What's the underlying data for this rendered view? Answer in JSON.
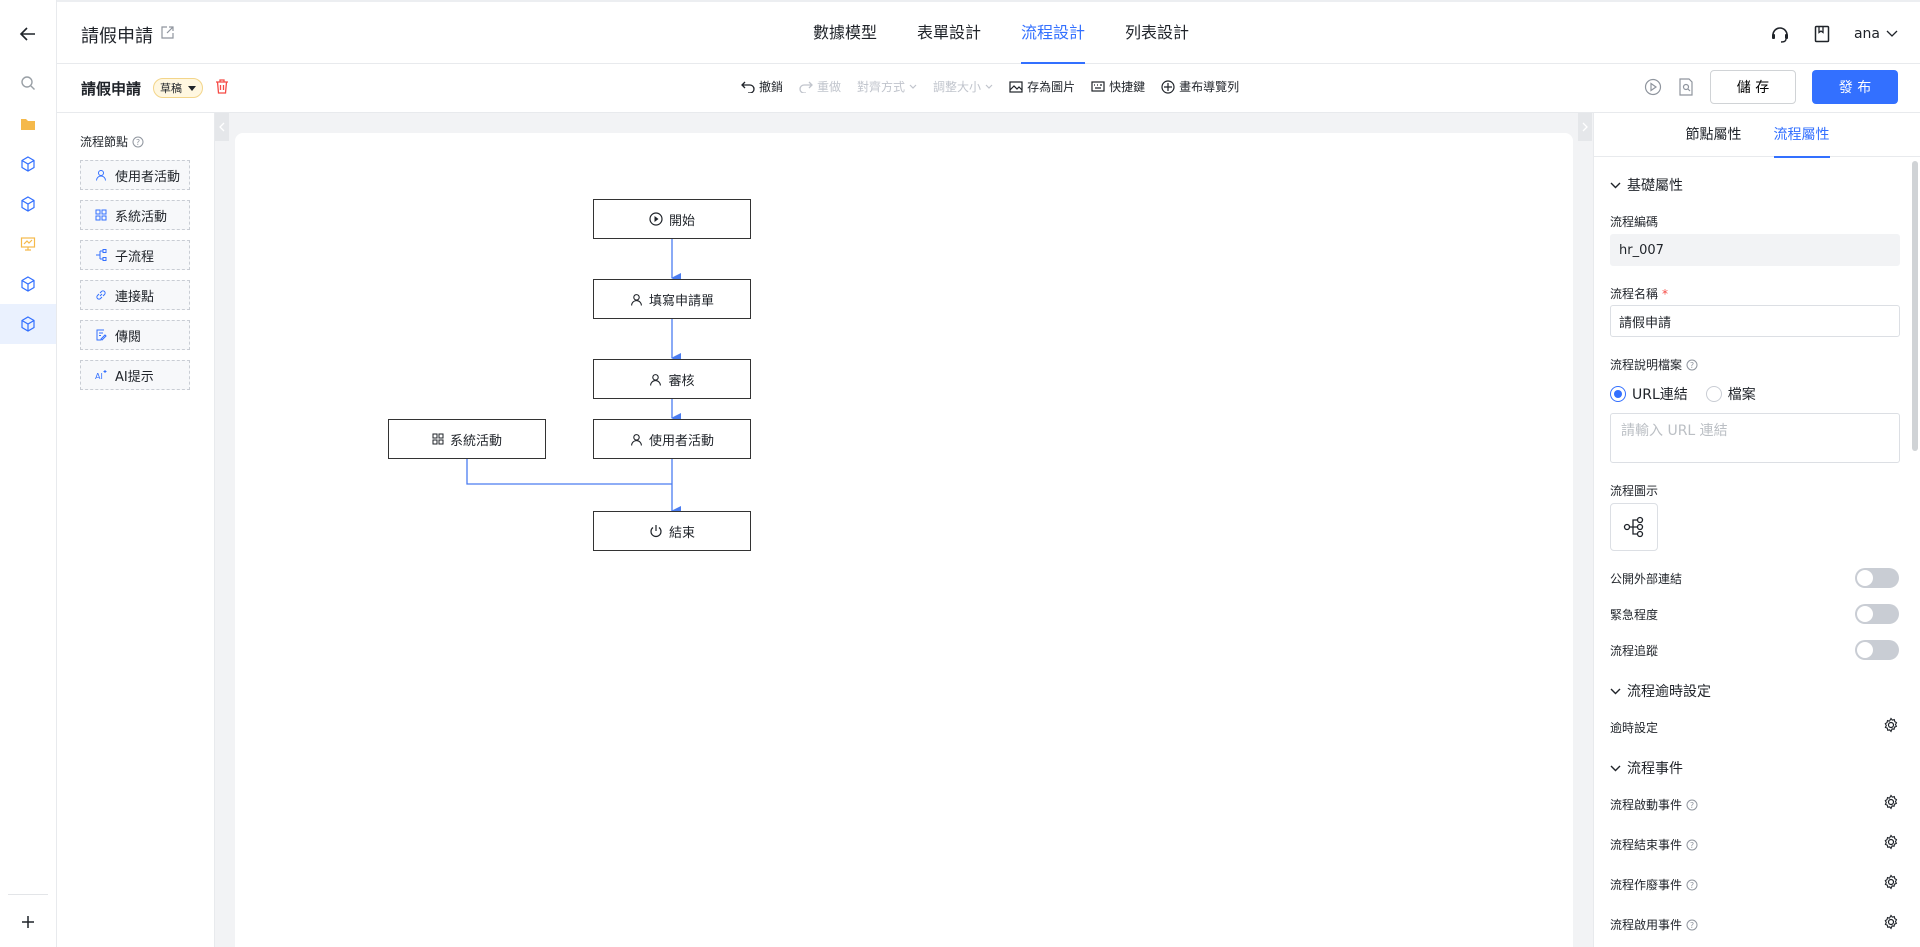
{
  "header": {
    "app_title": "請假申請",
    "tabs": [
      "數據模型",
      "表單設計",
      "流程設計",
      "列表設計"
    ],
    "active_tab": 2,
    "user": "ana"
  },
  "toolbar": {
    "form_name": "請假申請",
    "status_badge": "草稿",
    "undo": "撤銷",
    "redo": "重做",
    "align": "對齊方式",
    "resize": "調整大小",
    "save_image": "存為圖片",
    "shortcuts": "快捷鍵",
    "canvas_nav": "畫布導覽列",
    "save_label": "儲 存",
    "publish_label": "發 布"
  },
  "node_panel": {
    "title": "流程節點",
    "items": [
      {
        "label": "使用者活動",
        "icon": "user-icon"
      },
      {
        "label": "系統活動",
        "icon": "grid-icon"
      },
      {
        "label": "子流程",
        "icon": "subflow-icon"
      },
      {
        "label": "連接點",
        "icon": "link-icon"
      },
      {
        "label": "傳閱",
        "icon": "circulate-icon"
      },
      {
        "label": "AI提示",
        "icon": "ai-icon"
      }
    ]
  },
  "flow": {
    "start": "開始",
    "fill": "填寫申請單",
    "review": "審核",
    "user_activity": "使用者活動",
    "system_activity": "系統活動",
    "end": "結束"
  },
  "props": {
    "tabs": [
      "節點屬性",
      "流程屬性"
    ],
    "active_tab": 1,
    "basic_section": "基礎屬性",
    "code_label": "流程編碼",
    "code_value": "hr_007",
    "name_label": "流程名稱",
    "name_value": "請假申請",
    "doc_label": "流程說明檔案",
    "radio_url": "URL連結",
    "radio_file": "檔案",
    "url_placeholder": "請輸入 URL 連結",
    "icon_label": "流程圖示",
    "public_link": "公開外部連結",
    "urgency": "緊急程度",
    "tracking": "流程追蹤",
    "timeout_section": "流程逾時設定",
    "timeout_setting": "逾時設定",
    "events_section": "流程事件",
    "event_start": "流程啟動事件",
    "event_end": "流程結束事件",
    "event_void": "流程作廢事件",
    "event_enable": "流程啟用事件"
  },
  "colors": {
    "accent": "#3370ff",
    "edge": "#4a7cf0",
    "danger": "#f54a45",
    "folder": "#f5b94a"
  }
}
